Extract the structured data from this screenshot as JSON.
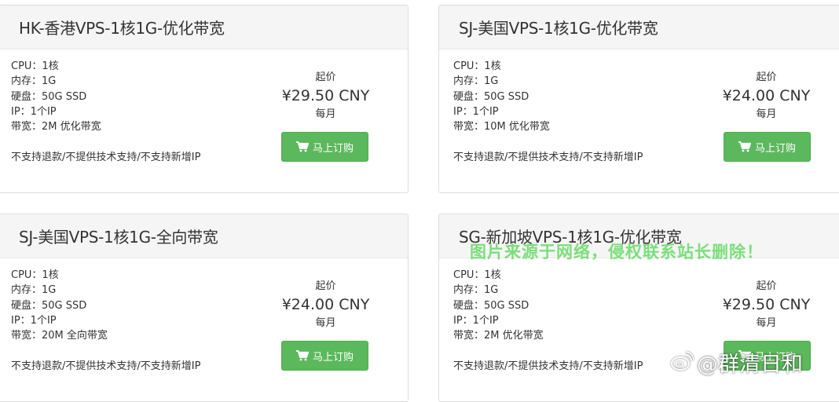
{
  "colors": {
    "order_button": "#5cb85c",
    "card_header_bg": "#f5f5f5",
    "card_border": "#dddddd",
    "watermark_overlay": "#6edc6e"
  },
  "cards": [
    {
      "title": "HK-香港VPS-1核1G-优化带宽",
      "specs": [
        "CPU：1核",
        "内存：1G",
        "硬盘：50G SSD",
        "IP：1个IP",
        "带宽：2M 优化带宽"
      ],
      "note": "不支持退款/不提供技术支持/不支持新增IP",
      "price_label": "起价",
      "price": "¥29.50 CNY",
      "period": "每月",
      "button_icon": "shopping-cart-icon",
      "button_label": "马上订购"
    },
    {
      "title": "SJ-美国VPS-1核1G-优化带宽",
      "specs": [
        "CPU：1核",
        "内存：1G",
        "硬盘：50G SSD",
        "IP：1个IP",
        "带宽：10M 优化带宽"
      ],
      "note": "不支持退款/不提供技术支持/不支持新增IP",
      "price_label": "起价",
      "price": "¥24.00 CNY",
      "period": "每月",
      "button_icon": "shopping-cart-icon",
      "button_label": "马上订购"
    },
    {
      "title": "SJ-美国VPS-1核1G-全向带宽",
      "specs": [
        "CPU：1核",
        "内存：1G",
        "硬盘：50G SSD",
        "IP：1个IP",
        "带宽：20M 全向带宽"
      ],
      "note": "不支持退款/不提供技术支持/不支持新增IP",
      "price_label": "起价",
      "price": "¥24.00 CNY",
      "period": "每月",
      "button_icon": "shopping-cart-icon",
      "button_label": "马上订购"
    },
    {
      "title": "SG-新加坡VPS-1核1G-优化带宽",
      "specs": [
        "CPU：1核",
        "内存：1G",
        "硬盘：50G SSD",
        "IP：1个IP",
        "带宽：2M 优化带宽"
      ],
      "note": "不支持退款/不提供技术支持/不支持新增IP",
      "price_label": "起价",
      "price": "¥29.50 CNY",
      "period": "每月",
      "button_icon": "shopping-cart-icon",
      "button_label": "马上订购"
    }
  ],
  "overlays": {
    "source_notice": "图片来源于网络，侵权联系站长删除！",
    "corner_watermark": "@群清日和",
    "corner_icon": "weibo-logo-icon"
  }
}
